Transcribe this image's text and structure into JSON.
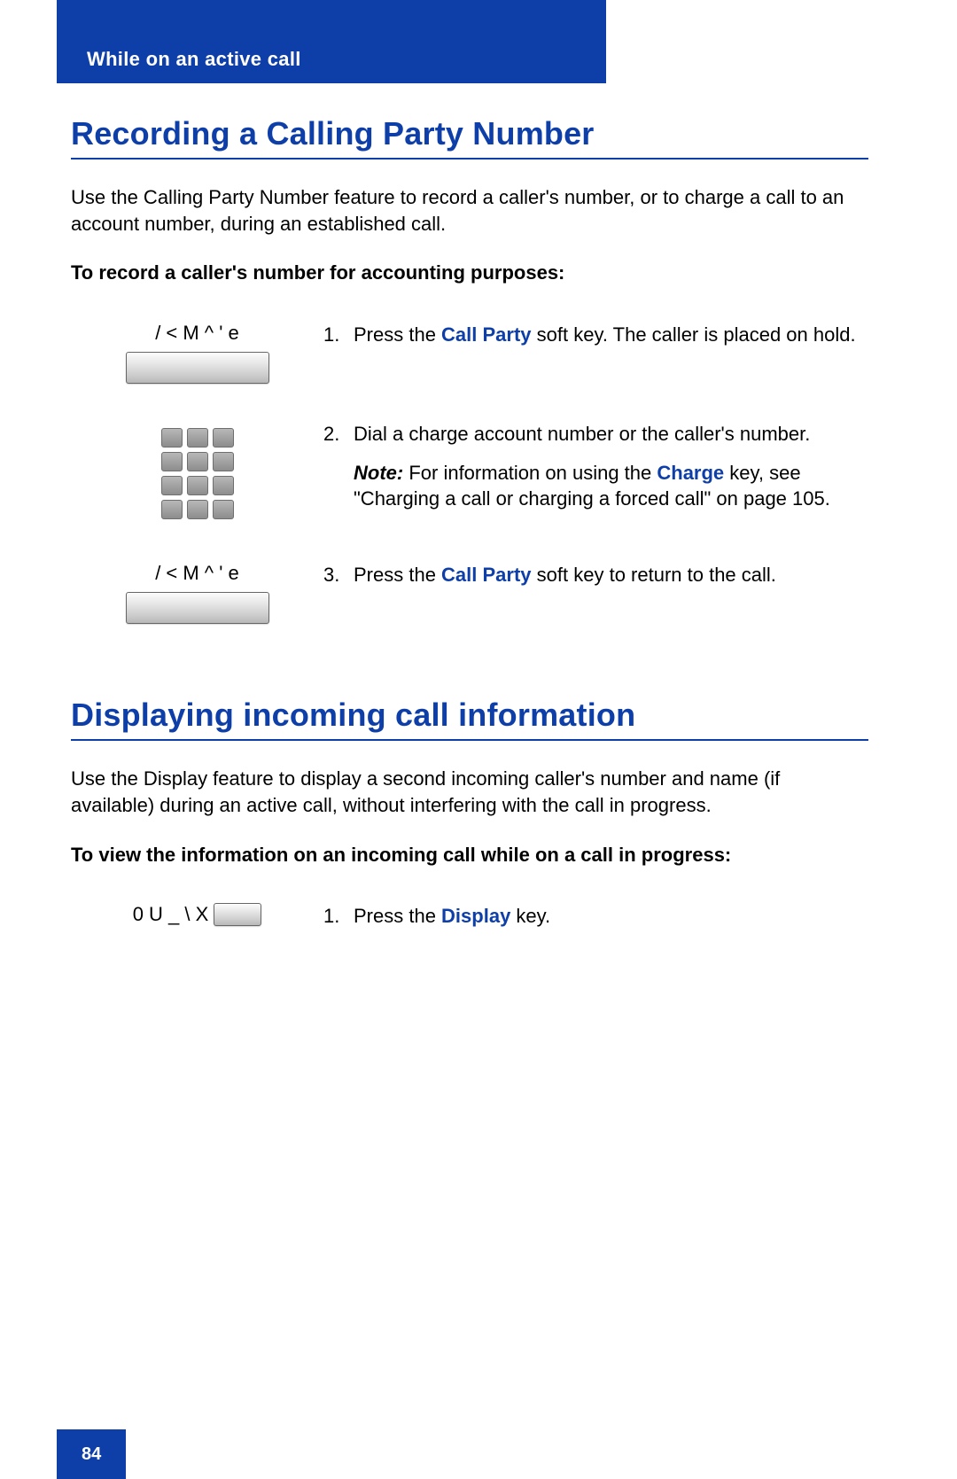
{
  "header": {
    "title": "While on an active call"
  },
  "footer": {
    "page_number": "84"
  },
  "colors": {
    "brand_blue": "#0e3fa9"
  },
  "section1": {
    "heading": "Recording a Calling Party Number",
    "intro": "Use the Calling Party Number feature to record a caller's number, or to charge a call to an account number, during an established call.",
    "task": "To record a caller's number for accounting purposes:",
    "steps": [
      {
        "icon": "softkey",
        "icon_label": "/ < M ^ ' e",
        "num": "1.",
        "text_before": "Press the ",
        "key": "Call Party",
        "text_after": " soft key. The caller is placed on hold."
      },
      {
        "icon": "keypad",
        "num": "2.",
        "line1": "Dial a charge account number or the caller's number.",
        "note_label": "Note:",
        "note_before": " For information on using the ",
        "note_key": "Charge",
        "note_after": " key, see \"Charging a call or charging a forced call\" on page 105."
      },
      {
        "icon": "softkey",
        "icon_label": "/ < M ^ ' e",
        "num": "3.",
        "text_before": "Press the ",
        "key": "Call Party",
        "text_after": " soft key to return to the call."
      }
    ]
  },
  "section2": {
    "heading": "Displaying incoming call information",
    "intro": "Use the Display feature to display a second incoming caller's number and name (if available) during an active call, without interfering with the call in progress.",
    "task": "To view the information on an incoming call while on a call in progress:",
    "steps": [
      {
        "icon": "inline-key",
        "icon_label": "0 U _ \\ X",
        "num": "1.",
        "text_before": "Press the ",
        "key": "Display",
        "text_after": " key."
      }
    ]
  }
}
